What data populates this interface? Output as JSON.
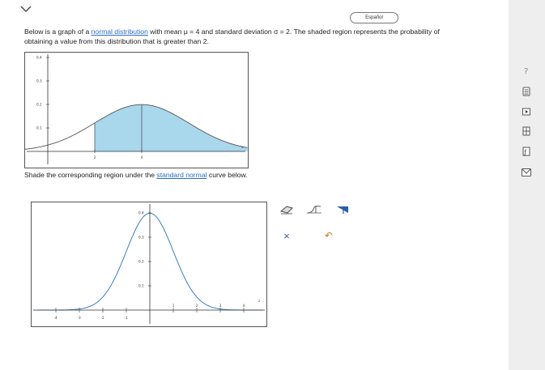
{
  "header": {
    "language_button": "Español"
  },
  "problem": {
    "text_before_link": "Below is a graph of a ",
    "link_text": "normal distribution",
    "text_mu": " with mean μ = 4 and standard deviation σ = 2. The shaded region represents the probability of obtaining a value from this distribution that is greater than 2."
  },
  "instruction": {
    "before": "Shade the corresponding region under the ",
    "link": "standard normal",
    "after": " curve below."
  },
  "tools": {
    "clear_label": "×",
    "undo_label": "↶"
  },
  "side_icons": [
    "help-icon",
    "calculator-icon",
    "video-icon",
    "table-icon",
    "formula-icon",
    "message-icon"
  ],
  "colors": {
    "shade": "#a9d7ec",
    "curve": "#3a7fc0",
    "link": "#2a6ec6",
    "tool_blue": "#2a5ea8",
    "tool_orange": "#c47a1c"
  },
  "chart_data": [
    {
      "type": "area",
      "distribution": "normal",
      "mean": 4,
      "sd": 2,
      "shaded_from": 2,
      "y_tick_labels": [
        "0.1",
        "0.2",
        "0.3",
        "0.4"
      ],
      "x_tick_labels": [
        "2",
        "4"
      ],
      "x_axis_label": "x"
    },
    {
      "type": "line",
      "distribution": "standard normal",
      "mean": 0,
      "sd": 1,
      "y_tick_labels": [
        "0.1",
        "0.2",
        "0.3",
        "0.4"
      ],
      "x_tick_labels": [
        "-4",
        "-3",
        "-2",
        "-1",
        "1",
        "2",
        "3",
        "4"
      ],
      "x_axis_label": "z"
    }
  ]
}
